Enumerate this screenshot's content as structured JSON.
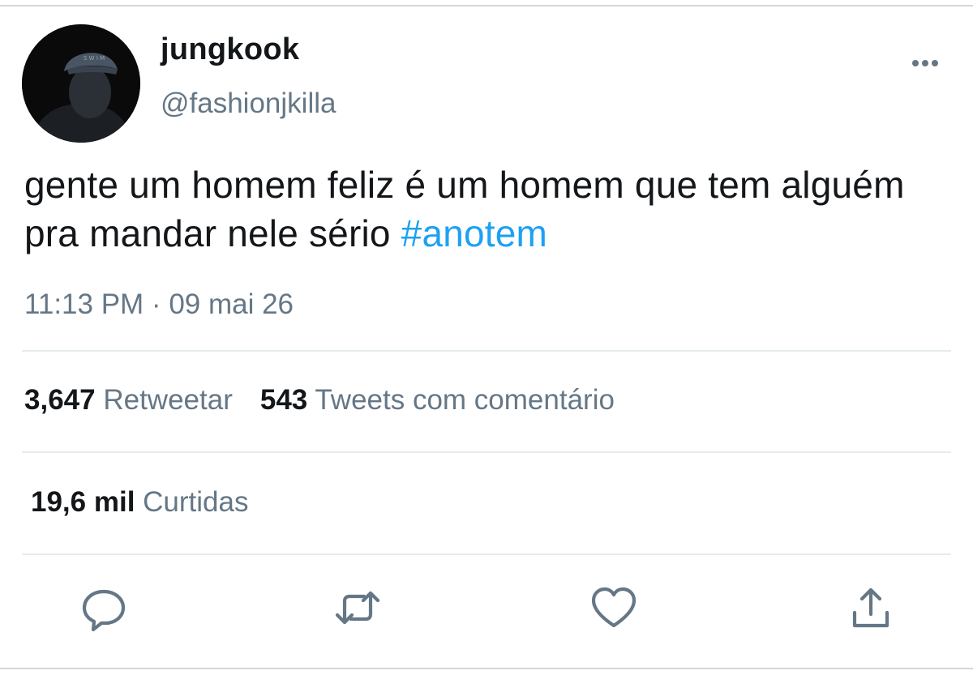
{
  "author": {
    "display_name": "jungkook",
    "handle": "@fashionjkilla",
    "avatar_icon": "profile-photo"
  },
  "tweet": {
    "text": "gente um homem feliz é um homem que tem alguém pra mandar nele sério ",
    "hashtag": "#anotem",
    "timestamp": "11:13 PM · 09 mai 26"
  },
  "stats": {
    "retweets_count": "3,647",
    "retweets_label": "Retweetar",
    "quotes_count": "543",
    "quotes_label": "Tweets com comentário",
    "likes_count": "19,6 mil",
    "likes_label": "Curtidas"
  },
  "actions": {
    "icons": [
      "reply-icon",
      "retweet-icon",
      "like-icon",
      "share-icon"
    ],
    "icon_color": "#657786"
  },
  "colors": {
    "hashtag": "#1da1f2",
    "secondary_text": "#657786",
    "primary_text": "#14171a",
    "divider": "#e6ecf0"
  }
}
